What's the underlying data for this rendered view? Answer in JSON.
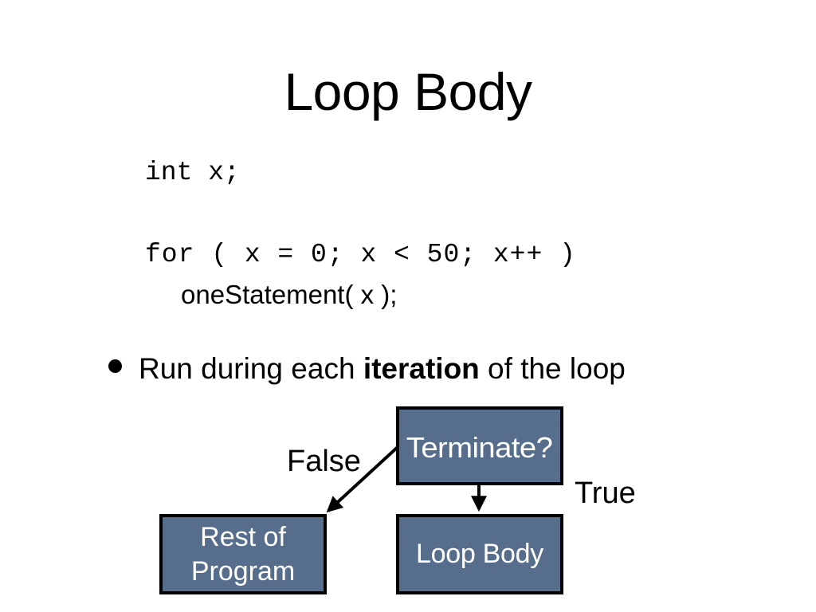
{
  "slide": {
    "title": "Loop Body",
    "background_color": "#ffffff",
    "text_color": "#000000"
  },
  "code": {
    "declaration": "int x;",
    "for_statement": "for ( x = 0; x < 50; x++ )",
    "body_statement": "oneStatement( x );"
  },
  "bullets": [
    {
      "marker": "bullet-dot",
      "text_before": "Run during each ",
      "emphasis": "iteration",
      "text_after": " of the loop"
    }
  ],
  "flowchart": {
    "box_fill_color": "#566e8c",
    "box_border_color": "#000000",
    "box_text_color": "#ffffff",
    "boxes": [
      {
        "id": "terminate",
        "label": "Terminate?"
      },
      {
        "id": "rest-of-program",
        "label": "Rest of\nProgram"
      },
      {
        "id": "loop-body",
        "label": "Loop Body"
      }
    ],
    "edges": [
      {
        "id": "false-edge",
        "label": "False",
        "from": "terminate",
        "to": "rest-of-program"
      },
      {
        "id": "true-edge",
        "label": "True",
        "from": "terminate",
        "to": "loop-body"
      }
    ]
  }
}
